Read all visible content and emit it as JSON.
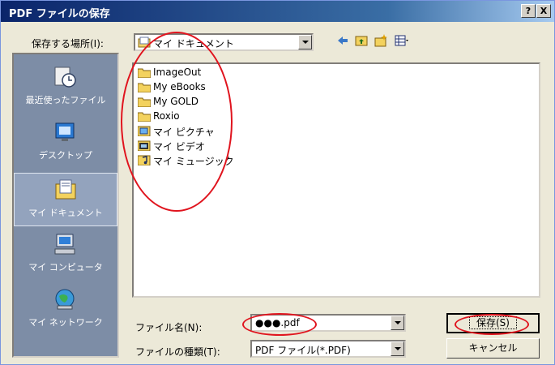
{
  "dialog": {
    "title": "PDF ファイルの保存"
  },
  "titlebar_buttons": {
    "help": "?",
    "close": "X"
  },
  "location": {
    "label": "保存する場所(I):",
    "value": "マイ ドキュメント"
  },
  "places": [
    {
      "label": "最近使ったファイル",
      "icon": "recent-files-icon"
    },
    {
      "label": "デスクトップ",
      "icon": "desktop-icon"
    },
    {
      "label": "マイ ドキュメント",
      "icon": "my-documents-icon"
    },
    {
      "label": "マイ コンピュータ",
      "icon": "my-computer-icon"
    },
    {
      "label": "マイ ネットワーク",
      "icon": "my-network-icon"
    }
  ],
  "files": [
    {
      "name": "ImageOut",
      "icon": "folder-icon"
    },
    {
      "name": "My eBooks",
      "icon": "folder-icon"
    },
    {
      "name": "My GOLD",
      "icon": "folder-icon"
    },
    {
      "name": "Roxio",
      "icon": "folder-icon"
    },
    {
      "name": "マイ ピクチャ",
      "icon": "pictures-folder-icon"
    },
    {
      "name": "マイ ビデオ",
      "icon": "video-folder-icon"
    },
    {
      "name": "マイ ミュージック",
      "icon": "music-folder-icon"
    }
  ],
  "filename": {
    "label": "ファイル名(N):",
    "value": "●●●.pdf"
  },
  "filetype": {
    "label": "ファイルの種類(T):",
    "value": "PDF ファイル(*.PDF)"
  },
  "buttons": {
    "save": "保存(S)",
    "cancel": "キャンセル"
  },
  "colors": {
    "annotation": "#e0141e",
    "titlebar": "#0a246a",
    "sidebar": "#7d8da6"
  }
}
